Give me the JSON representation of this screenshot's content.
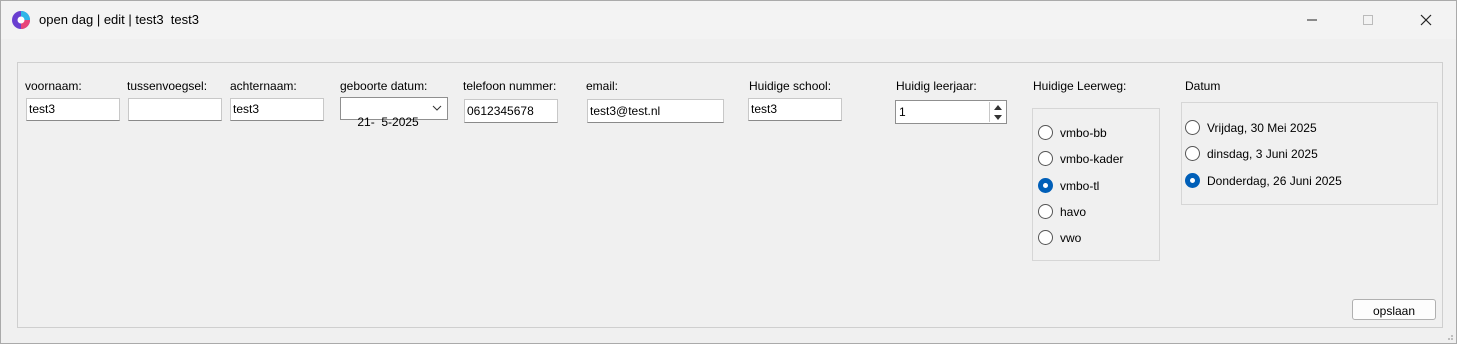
{
  "window": {
    "title": "open dag | edit | test3  test3"
  },
  "form": {
    "voornaam": {
      "label": "voornaam:",
      "value": "test3"
    },
    "tussenvoegsel": {
      "label": "tussenvoegsel:",
      "value": ""
    },
    "achternaam": {
      "label": "achternaam:",
      "value": "test3"
    },
    "geboortedatum": {
      "label": "geboorte datum:",
      "value": "21-  5-2025"
    },
    "telefoon": {
      "label": "telefoon nummer:",
      "value": "0612345678"
    },
    "email": {
      "label": "email:",
      "value": "test3@test.nl"
    },
    "school": {
      "label": "Huidige school:",
      "value": "test3"
    },
    "leerjaar": {
      "label": "Huidig leerjaar:",
      "value": "1"
    }
  },
  "leerweg": {
    "label": "Huidige Leerweg:",
    "options": [
      {
        "label": "vmbo-bb",
        "selected": false
      },
      {
        "label": "vmbo-kader",
        "selected": false
      },
      {
        "label": "vmbo-tl",
        "selected": true
      },
      {
        "label": "havo",
        "selected": false
      },
      {
        "label": "vwo",
        "selected": false
      }
    ]
  },
  "datum": {
    "label": "Datum",
    "options": [
      {
        "label": "Vrijdag, 30 Mei 2025",
        "selected": false
      },
      {
        "label": "dinsdag, 3 Juni 2025",
        "selected": false
      },
      {
        "label": "Donderdag, 26 Juni 2025",
        "selected": true
      }
    ]
  },
  "actions": {
    "save_label": "opslaan"
  },
  "colors": {
    "accent": "#005fb8"
  }
}
